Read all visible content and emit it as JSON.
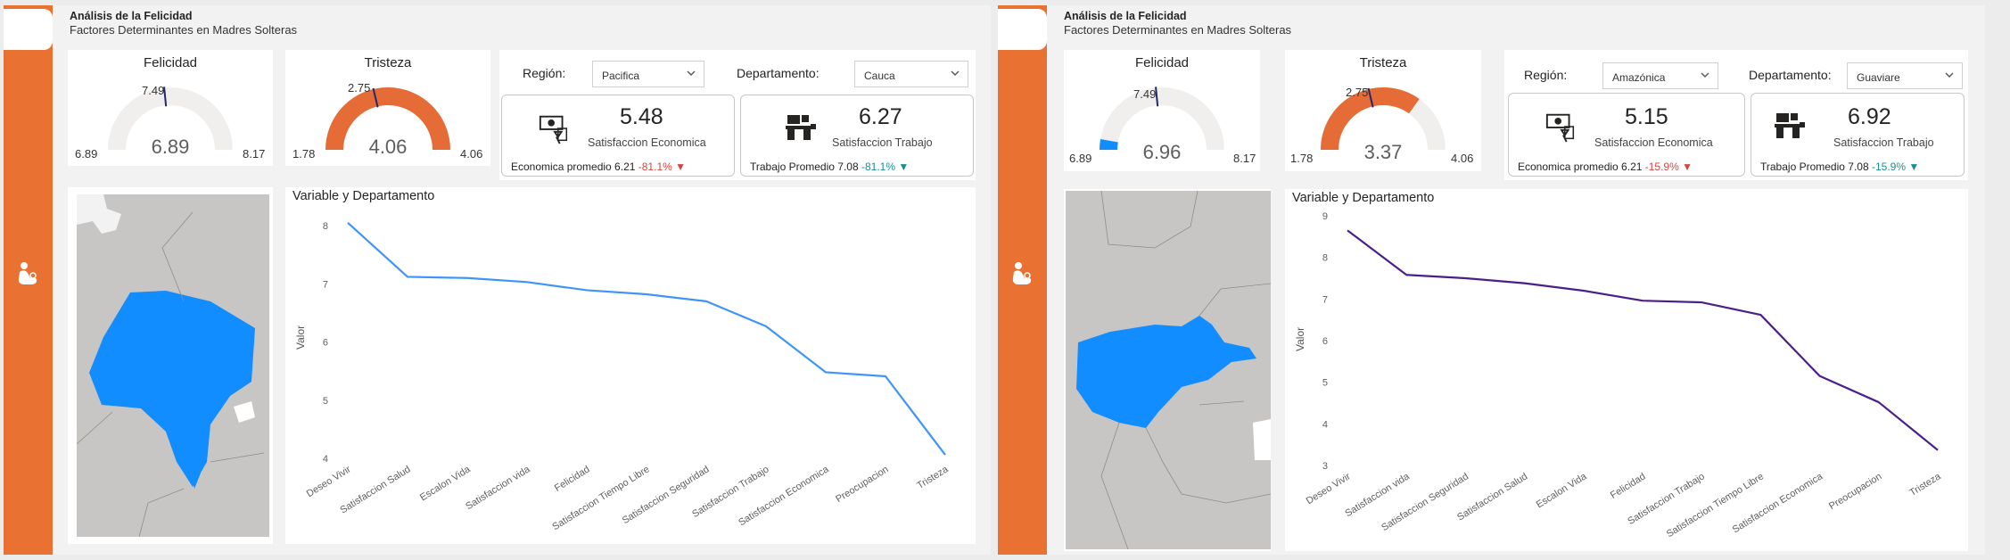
{
  "panels": [
    {
      "header": {
        "title": "Análisis de la Felicidad",
        "subtitle": "Factores Determinantes en Madres Solteras"
      },
      "gauges": [
        {
          "title": "Felicidad",
          "min": "6.89",
          "max": "8.17",
          "target": "7.49",
          "value": "6.89",
          "value_num": 6.89,
          "min_num": 6.89,
          "max_num": 8.17,
          "target_num": 7.49,
          "fill_color": "#118dff"
        },
        {
          "title": "Tristeza",
          "min": "1.78",
          "max": "4.06",
          "target": "2.75",
          "value": "4.06",
          "value_num": 4.06,
          "min_num": 1.78,
          "max_num": 4.06,
          "target_num": 2.75,
          "fill_color": "#e66c37"
        }
      ],
      "filters": {
        "region_label": "Región:",
        "region_value": "Pacifica",
        "depto_label": "Departamento:",
        "depto_value": "Cauca"
      },
      "kpis": [
        {
          "value": "5.48",
          "label": "Satisfaccion Economica",
          "foot_text": "Economica promedio 6.21",
          "delta": "-81.1%",
          "delta_dir": "down",
          "icon": "money-icon"
        },
        {
          "value": "6.27",
          "label": "Satisfaccion Trabajo",
          "foot_text": "Trabajo Promedio 7.08",
          "delta": "-81.1%",
          "delta_dir": "down-teal",
          "icon": "workstation-icon"
        }
      ],
      "map": {
        "highlight_color": "#118dff",
        "base_color": "#c8c6c4"
      },
      "chart_data": {
        "type": "line",
        "title": "Variable y Departamento",
        "ylabel": "Valor",
        "xlabel": "",
        "ylim": [
          4,
          8.2
        ],
        "yticks": [
          4,
          5,
          6,
          7,
          8
        ],
        "categories": [
          "Deseo Vivir",
          "Satisfaccion Salud",
          "Escalon Vida",
          "Satisfaccion vida",
          "Felicidad",
          "Satisfaccion Tiempo Libre",
          "Satisfaccion Seguridad",
          "Satisfaccion Trabajo",
          "Satisfaccion Economica",
          "Preocupacion",
          "Tristeza"
        ],
        "values": [
          8.05,
          7.12,
          7.1,
          7.03,
          6.89,
          6.82,
          6.7,
          6.27,
          5.48,
          5.41,
          4.06
        ],
        "color": "#3f95f7"
      }
    },
    {
      "header": {
        "title": "Análisis de la Felicidad",
        "subtitle": "Factores Determinantes en Madres Solteras"
      },
      "gauges": [
        {
          "title": "Felicidad",
          "min": "6.89",
          "max": "8.17",
          "target": "7.49",
          "value": "6.96",
          "value_num": 6.96,
          "min_num": 6.89,
          "max_num": 8.17,
          "target_num": 7.49,
          "fill_color": "#118dff"
        },
        {
          "title": "Tristeza",
          "min": "1.78",
          "max": "4.06",
          "target": "2.75",
          "value": "3.37",
          "value_num": 3.37,
          "min_num": 1.78,
          "max_num": 4.06,
          "target_num": 2.75,
          "fill_color": "#e66c37"
        }
      ],
      "filters": {
        "region_label": "Región:",
        "region_value": "Amazónica",
        "depto_label": "Departamento:",
        "depto_value": "Guaviare"
      },
      "kpis": [
        {
          "value": "5.15",
          "label": "Satisfaccion Economica",
          "foot_text": "Economica promedio 6.21",
          "delta": "-15.9%",
          "delta_dir": "down",
          "icon": "money-icon"
        },
        {
          "value": "6.92",
          "label": "Satisfaccion Trabajo",
          "foot_text": "Trabajo Promedio 7.08",
          "delta": "-15.9%",
          "delta_dir": "down-teal",
          "icon": "workstation-icon"
        }
      ],
      "map": {
        "highlight_color": "#118dff",
        "base_color": "#c8c6c4"
      },
      "chart_data": {
        "type": "line",
        "title": "Variable y Departamento",
        "ylabel": "Valor",
        "xlabel": "",
        "ylim": [
          3,
          9
        ],
        "yticks": [
          3,
          4,
          5,
          6,
          7,
          8,
          9
        ],
        "categories": [
          "Deseo Vivir",
          "Satisfaccion vida",
          "Satisfaccion Seguridad",
          "Satisfaccion Salud",
          "Escalon Vida",
          "Felicidad",
          "Satisfaccion Trabajo",
          "Satisfaccion Tiempo Libre",
          "Satisfaccion Economica",
          "Preocupacion",
          "Tristeza"
        ],
        "values": [
          8.65,
          7.58,
          7.5,
          7.38,
          7.2,
          6.96,
          6.92,
          6.62,
          5.15,
          4.52,
          3.37
        ],
        "color": "#4b1f8a"
      }
    }
  ]
}
